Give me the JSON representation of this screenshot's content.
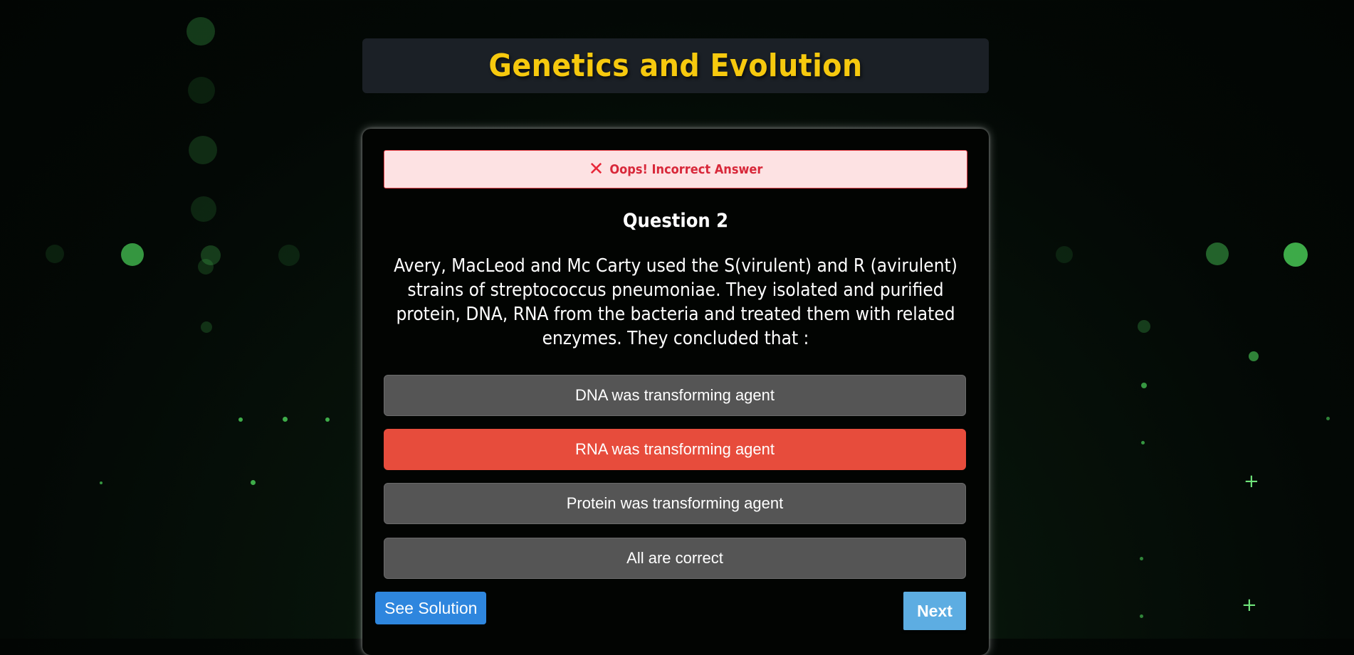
{
  "header": {
    "title": "Genetics and Evolution"
  },
  "feedback": {
    "icon": "close-icon",
    "message": "Oops! Incorrect Answer"
  },
  "question": {
    "label": "Question 2",
    "text": "Avery, MacLeod and Mc Carty used the S(virulent) and R (avirulent) strains of streptococcus pneumoniae. They isolated and purified protein, DNA, RNA from the bacteria and treated them with related enzymes. They concluded that :"
  },
  "options": [
    {
      "label": "DNA was transforming agent",
      "state": "default"
    },
    {
      "label": "RNA was transforming agent",
      "state": "incorrect-selected"
    },
    {
      "label": "Protein was transforming agent",
      "state": "default"
    },
    {
      "label": "All are correct",
      "state": "default"
    }
  ],
  "actions": {
    "see_solution_label": "See Solution",
    "next_label": "Next"
  },
  "colors": {
    "title": "#f6c90e",
    "incorrect": "#e74c3c",
    "option_default": "#555555",
    "solution_button": "#2e86de",
    "next_button": "#5dade2"
  }
}
